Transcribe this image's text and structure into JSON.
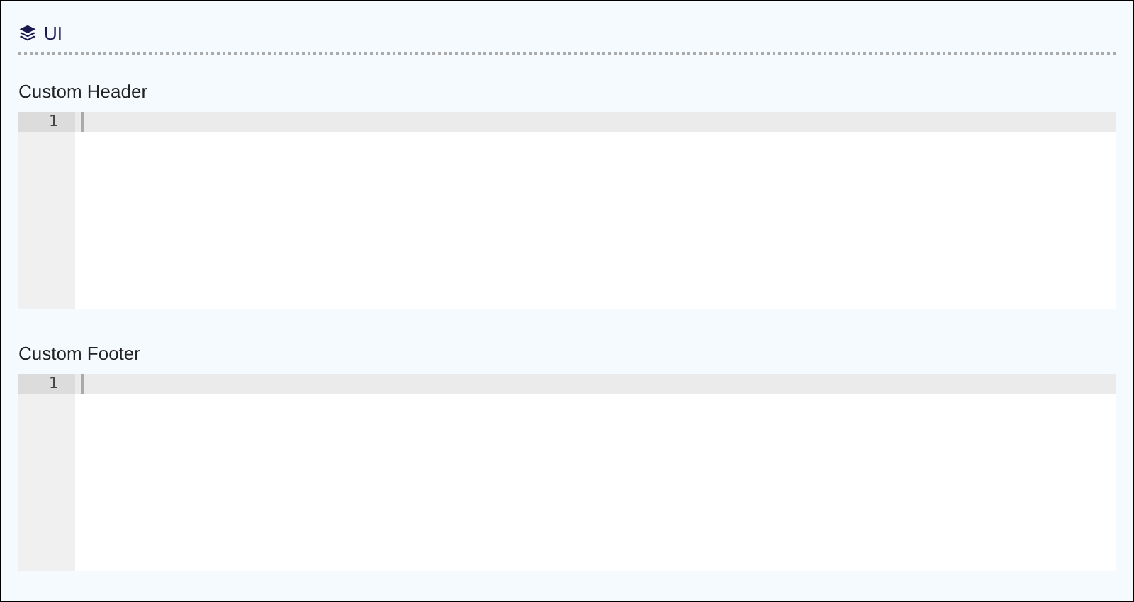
{
  "section": {
    "title": "UI"
  },
  "editors": [
    {
      "label": "Custom Header",
      "line_numbers": [
        "1"
      ]
    },
    {
      "label": "Custom Footer",
      "line_numbers": [
        "1"
      ]
    }
  ]
}
